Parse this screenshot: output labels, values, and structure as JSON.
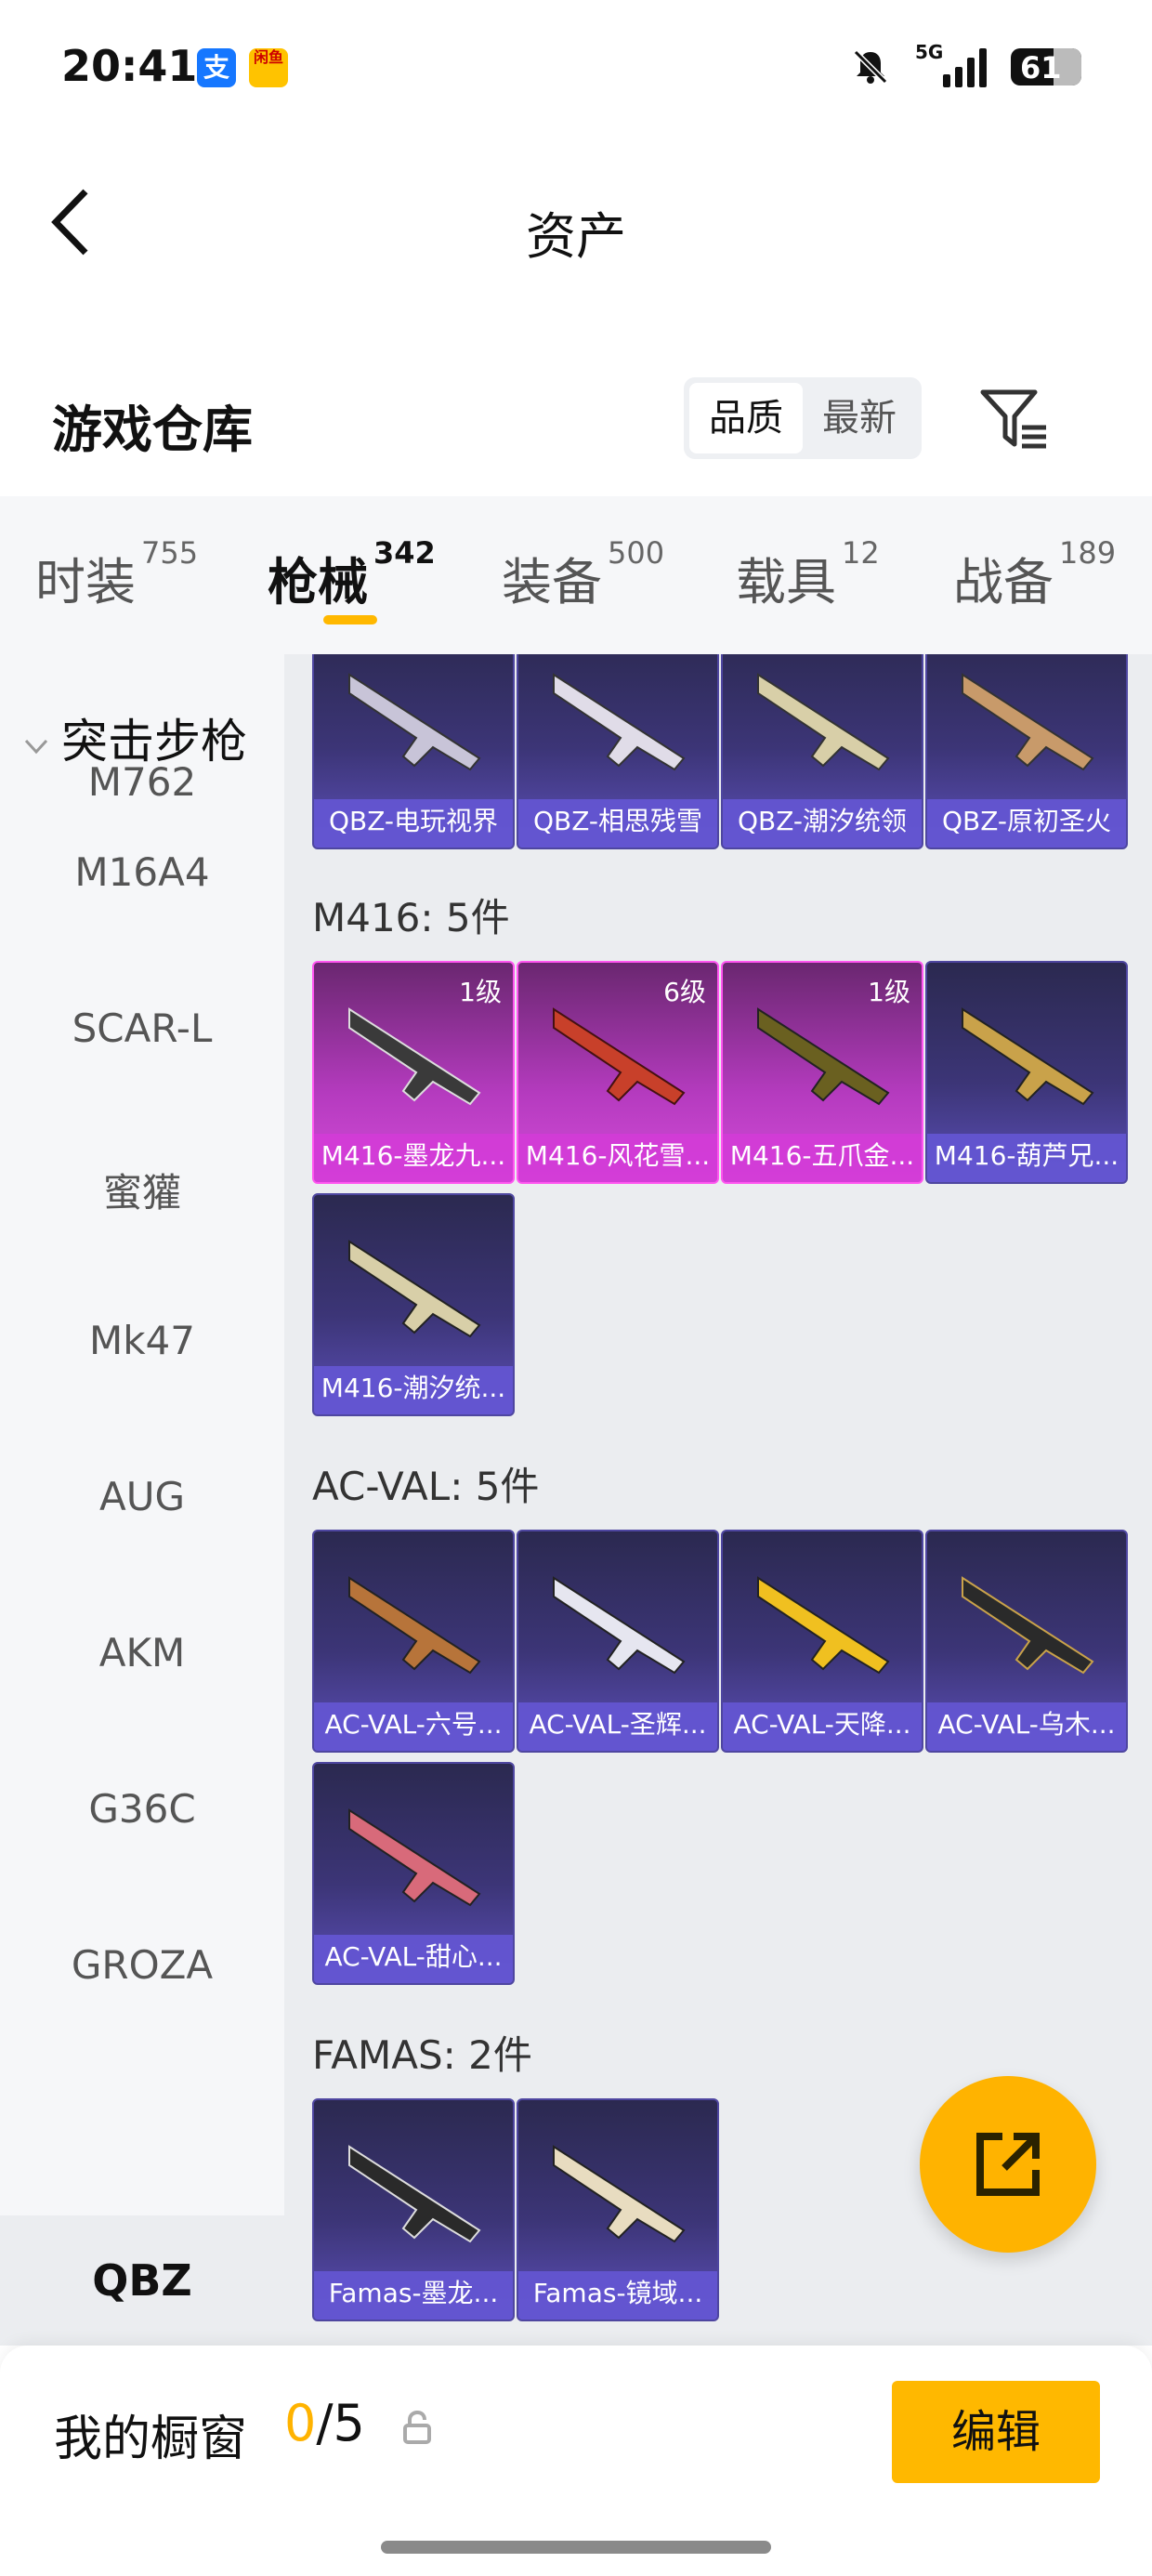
{
  "status_bar": {
    "time": "20:41",
    "apps": [
      {
        "icon": "alipay-icon",
        "glyph": "支"
      },
      {
        "icon": "app-icon",
        "glyph": "闲鱼"
      }
    ],
    "network": "5G",
    "battery": "61"
  },
  "header": {
    "title": "资产",
    "back_icon": "back-arrow-icon"
  },
  "warehouse": {
    "title": "游戏仓库",
    "sort_options": [
      {
        "label": "品质",
        "active": true
      },
      {
        "label": "最新",
        "active": false
      }
    ],
    "filter_icon": "filter-icon"
  },
  "tabs": [
    {
      "label": "时装",
      "count": "755",
      "active": false
    },
    {
      "label": "枪械",
      "count": "342",
      "active": true
    },
    {
      "label": "装备",
      "count": "500",
      "active": false
    },
    {
      "label": "载具",
      "count": "12",
      "active": false
    },
    {
      "label": "战备",
      "count": "189",
      "active": false
    }
  ],
  "sidebar": {
    "group": "突击步枪",
    "items": [
      "M762",
      "M16A4",
      "SCAR-L",
      "蜜獾",
      "Mk47",
      "AUG",
      "AKM",
      "G36C",
      "GROZA",
      "QBZ"
    ],
    "selected": "QBZ"
  },
  "sections": [
    {
      "title": "",
      "items": [
        {
          "name": "QBZ-电玩视界",
          "level": "",
          "rarity": "blue"
        },
        {
          "name": "QBZ-相思残雪",
          "level": "",
          "rarity": "blue"
        },
        {
          "name": "QBZ-潮汐统领",
          "level": "",
          "rarity": "blue"
        },
        {
          "name": "QBZ-原初圣火",
          "level": "",
          "rarity": "blue"
        }
      ]
    },
    {
      "title": "M416: 5件",
      "items": [
        {
          "name": "M416-墨龙九...",
          "level": "1级",
          "rarity": "purple"
        },
        {
          "name": "M416-风花雪...",
          "level": "6级",
          "rarity": "purple"
        },
        {
          "name": "M416-五爪金...",
          "level": "1级",
          "rarity": "purple"
        },
        {
          "name": "M416-葫芦兄...",
          "level": "",
          "rarity": "blue"
        },
        {
          "name": "M416-潮汐统...",
          "level": "",
          "rarity": "blue"
        }
      ]
    },
    {
      "title": "AC-VAL: 5件",
      "items": [
        {
          "name": "AC-VAL-六号...",
          "level": "",
          "rarity": "blue"
        },
        {
          "name": "AC-VAL-圣辉...",
          "level": "",
          "rarity": "blue"
        },
        {
          "name": "AC-VAL-天降...",
          "level": "",
          "rarity": "blue"
        },
        {
          "name": "AC-VAL-乌木...",
          "level": "",
          "rarity": "blue"
        },
        {
          "name": "AC-VAL-甜心...",
          "level": "",
          "rarity": "blue"
        }
      ]
    },
    {
      "title": "FAMAS: 2件",
      "items": [
        {
          "name": "Famas-墨龙...",
          "level": "",
          "rarity": "blue"
        },
        {
          "name": "Famas-镜域...",
          "level": "",
          "rarity": "blue"
        }
      ]
    }
  ],
  "fab": {
    "icon": "share-external-icon"
  },
  "bottom_bar": {
    "label": "我的橱窗",
    "count_current": "0",
    "count_total": "/5",
    "lock_icon": "lock-icon",
    "edit_label": "编辑"
  },
  "colors": {
    "accent": "#ffb300",
    "card_blue": "#3c3577",
    "card_purple": "#b53bbf"
  }
}
